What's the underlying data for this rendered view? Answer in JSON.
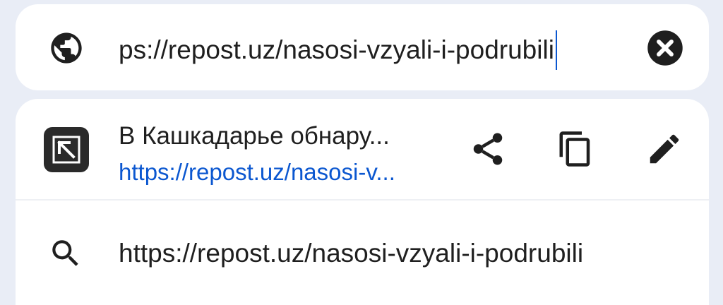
{
  "url_bar": {
    "value": "ps://repost.uz/nasosi-vzyali-i-podrubili",
    "icons": {
      "leading": "globe-icon",
      "trailing": "clear-icon"
    }
  },
  "suggestion_top": {
    "title": "В Кашкадарье обнару...",
    "url": "https://repost.uz/nasosi-v...",
    "icons": {
      "leading": "arrow-up-left-icon",
      "share": "share-icon",
      "copy": "copy-icon",
      "edit": "edit-icon"
    }
  },
  "suggestion_search": {
    "text": "https://repost.uz/nasosi-vzyali-i-podrubili",
    "icon": "search-icon"
  },
  "colors": {
    "background": "#e9edf6",
    "surface": "#ffffff",
    "text": "#1f1f1f",
    "link": "#0b57d0",
    "icon": "#1f1f1f"
  }
}
